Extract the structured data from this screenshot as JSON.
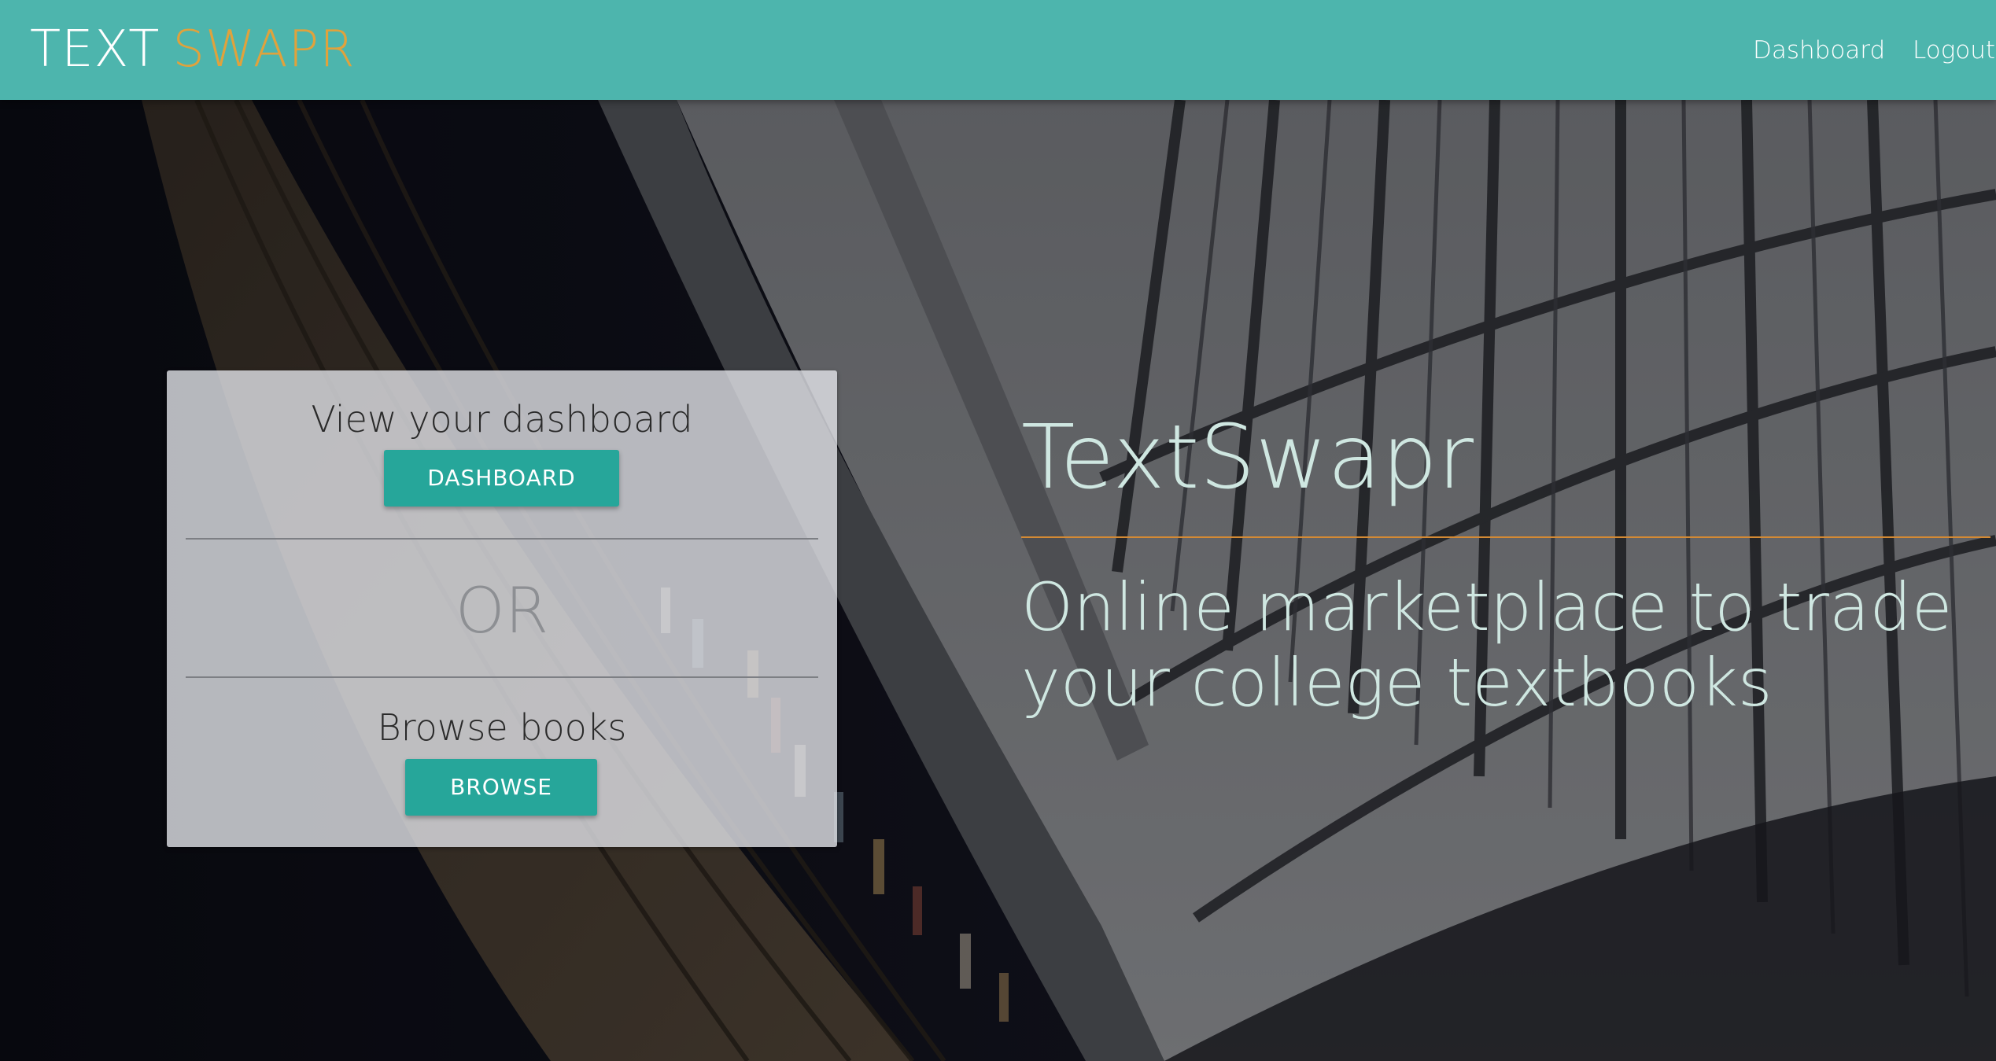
{
  "navbar": {
    "brand_first": "TEXT",
    "brand_second": "SWAPR",
    "links": {
      "dashboard": "Dashboard",
      "logout": "Logout"
    }
  },
  "card": {
    "dashboard_heading": "View your dashboard",
    "dashboard_button": "DASHBOARD",
    "or_text": "OR",
    "browse_heading": "Browse books",
    "browse_button": "BROWSE"
  },
  "hero": {
    "title": "TextSwapr",
    "tagline": "Online marketplace to trade your college textbooks"
  },
  "colors": {
    "navbar": "#4db5ad",
    "brand_accent": "#e0a23c",
    "button": "#26a69a",
    "rule": "#d48a34",
    "hero_text": "#cfe7e1"
  }
}
